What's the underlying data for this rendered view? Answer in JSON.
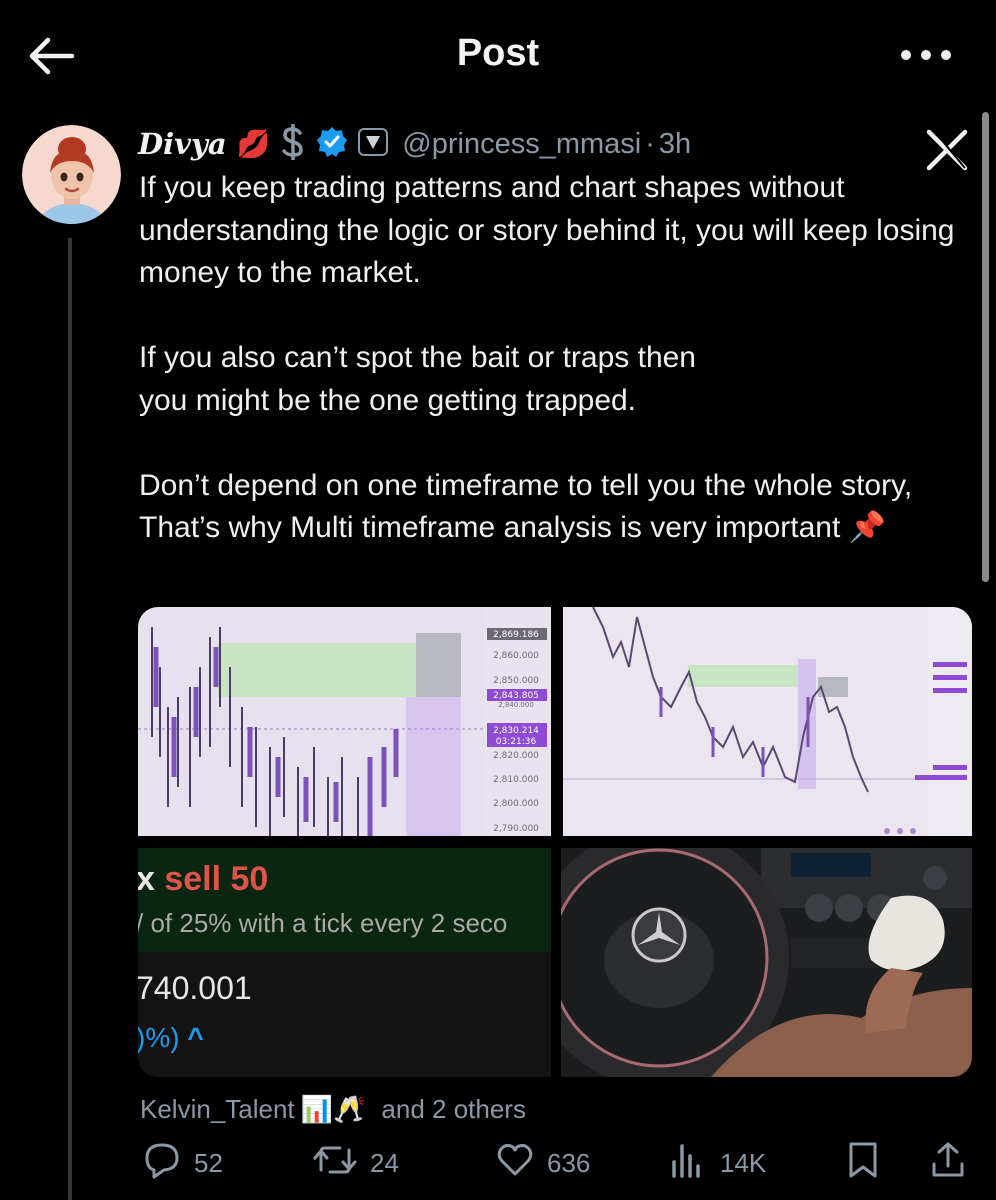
{
  "header": {
    "title": "Post"
  },
  "post": {
    "author_name": "Divya",
    "author_emojis": "💋",
    "handle": "@princess_mmasi",
    "separator": "·",
    "time": "3h",
    "text": "If you keep trading patterns and chart shapes without understanding the logic or story behind it, you will keep losing money to the market.\n\nIf you also can’t spot the bait or traps then\nyou might be the one getting trapped.\n\nDon’t depend on one timeframe to tell you the whole story, That’s why Multi timeframe analysis is very important 📌"
  },
  "media": {
    "chart1_prices": [
      "2,869.186",
      "2,860.000",
      "2,850.000",
      "2,843.805",
      "2,840.000",
      "2,830.214",
      "03:21:36",
      "2,820.000",
      "2,810.000",
      "2,800.000",
      "2,790.000"
    ],
    "trade": {
      "title_prefix": "x ",
      "title_main": "sell 50",
      "subtitle": "/ of 25% with a tick every 2 seco",
      "price": "740.001",
      "change": ")%)",
      "change_arrow": "^"
    }
  },
  "social": {
    "liked_by_name": "Kelvin_Talent",
    "liked_by_emoji": "📊🥂",
    "liked_by_others": "and 2 others"
  },
  "actions": {
    "replies": "52",
    "reposts": "24",
    "likes": "636",
    "views": "14K"
  },
  "colors": {
    "accent_blue": "#1d9bf0",
    "muted": "#8b98a5",
    "trade_green": "#e0534a"
  }
}
